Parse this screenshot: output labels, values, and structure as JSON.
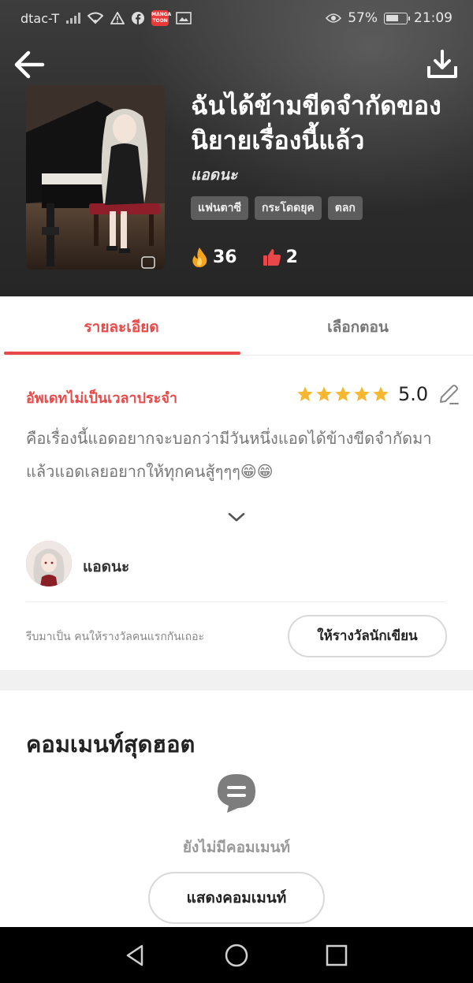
{
  "status_bar": {
    "carrier": "dtac-T",
    "battery_percent": "57%",
    "time": "21:09",
    "app_badge": "MANGA TOON"
  },
  "header": {
    "back_icon": "arrow-left-icon",
    "download_icon": "download-icon"
  },
  "book": {
    "title": "ฉันได้ข้ามขีดจำกัดของนิยายเรื่องนี้แล้ว",
    "author": "แอดนะ",
    "tags": [
      "แฟนตาซี",
      "กระโดดยุค",
      "ตลก"
    ],
    "fire_count": "36",
    "like_count": "2"
  },
  "tabs": {
    "details": "รายละเอียด",
    "episodes": "เลือกตอน"
  },
  "details": {
    "update_schedule": "อัพเดทไม่เป็นเวลาประจำ",
    "rating": "5.0",
    "stars": 5,
    "description": "คือเรื่องนี้แอดอยากจะบอกว่ามีวันหนึ่งแอดได้ข้างขีดจำกัดมาแล้วแอดเลยอยากให้ทุกคนสู้ๆๆๆ😁😁"
  },
  "author_section": {
    "name": "แอดนะ",
    "reward_prompt": "รีบมาเป็น คนให้รางวัลคนแรกกันเถอะ",
    "reward_button": "ให้รางวัลนักเขียน"
  },
  "comments": {
    "title": "คอมเมนท์สุดฮอต",
    "empty_text": "ยังไม่มีคอมเมนท์",
    "show_button": "แสดงคอมเมนท์"
  },
  "colors": {
    "accent": "#e84a4a",
    "star": "#f7b731"
  }
}
